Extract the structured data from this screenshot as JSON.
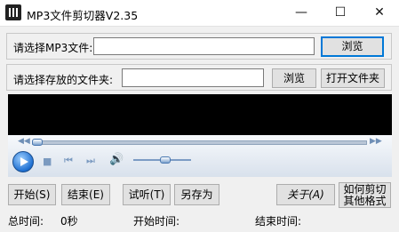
{
  "window": {
    "title": "MP3文件剪切器V2.35",
    "minimize_glyph": "—",
    "maximize_glyph": "☐",
    "close_glyph": "✕"
  },
  "file_row": {
    "label": "请选择MP3文件:",
    "value": "",
    "browse_label": "浏览"
  },
  "folder_row": {
    "label": "请选择存放的文件夹:",
    "value": "",
    "browse_label": "浏览",
    "open_folder_label": "打开文件夹"
  },
  "player": {
    "position": 0,
    "volume": 0.5
  },
  "buttons": {
    "start": "开始(S)",
    "end": "结束(E)",
    "preview": "试听(T)",
    "save_as": "另存为",
    "about": "关于(A)",
    "how_to_line1": "如何剪切",
    "how_to_line2": "其他格式"
  },
  "status": {
    "total_label": "总时间:",
    "total_value": "0秒",
    "start_label": "开始时间:",
    "start_value": "",
    "end_label": "结束时间:",
    "end_value": ""
  }
}
